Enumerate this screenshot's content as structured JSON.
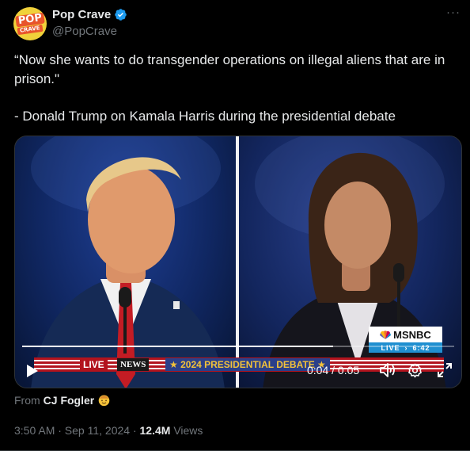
{
  "author": {
    "display_name": "Pop Crave",
    "handle": "@PopCrave",
    "avatar_text_top": "POP",
    "avatar_text_bottom": "CRAVE",
    "verified": true
  },
  "more_label": "···",
  "tweet": {
    "line1": "“Now she wants to do transgender operations on illegal aliens that are in prison.\"",
    "line2": "- Donald Trump on Kamala Harris during the presidential debate"
  },
  "video": {
    "network_logo": "MSNBC",
    "live_label": "LIVE",
    "live_time": "6:42",
    "ticker_live": "LIVE",
    "ticker_news": "NEWS",
    "ticker_title": "★ 2024 PRESIDENTIAL DEBATE ★",
    "time_display": "0:04 / 0:05",
    "progress": 0.72
  },
  "attribution": {
    "from_label": "From",
    "source_name": "CJ Fogler"
  },
  "meta": {
    "timestamp": "3:50 AM · Sep 11, 2024 · ",
    "views_count": "12.4M",
    "views_label": " Views"
  },
  "colors": {
    "background": "#000000",
    "text_primary": "#e7e9ea",
    "text_secondary": "#71767b",
    "verified_blue": "#1d9bf0",
    "ticker_red": "#b2131d",
    "ticker_gold": "#f3c23a"
  },
  "icons": [
    "verified-icon",
    "more-icon",
    "play-icon",
    "volume-icon",
    "settings-icon",
    "fullscreen-icon",
    "emoji-icon"
  ]
}
